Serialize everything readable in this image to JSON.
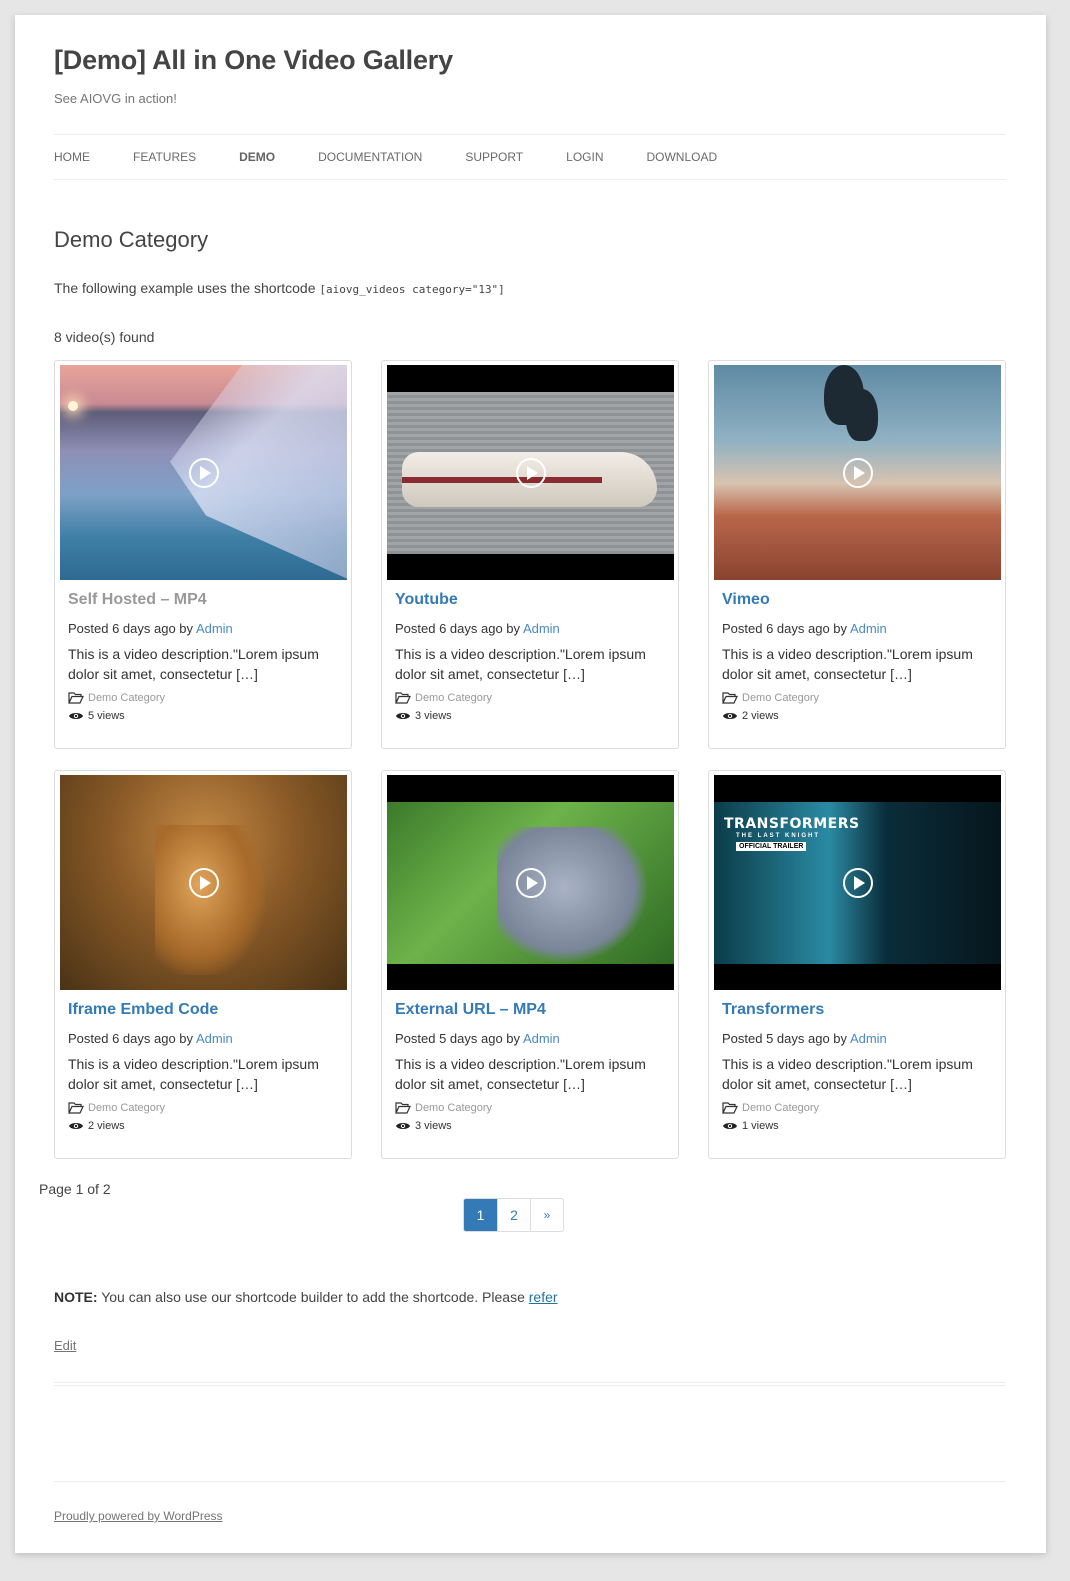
{
  "site": {
    "title": "[Demo] All in One Video Gallery",
    "description": "See AIOVG in action!"
  },
  "nav": {
    "items": [
      {
        "label": "HOME",
        "active": false
      },
      {
        "label": "FEATURES",
        "active": false
      },
      {
        "label": "DEMO",
        "active": true
      },
      {
        "label": "DOCUMENTATION",
        "active": false
      },
      {
        "label": "SUPPORT",
        "active": false
      },
      {
        "label": "LOGIN",
        "active": false
      },
      {
        "label": "DOWNLOAD",
        "active": false
      }
    ]
  },
  "page": {
    "title": "Demo Category",
    "intro_text": "The following example uses the shortcode",
    "shortcode": "[aiovg_videos category=\"13\"]",
    "count_text": "8 video(s) found"
  },
  "videos": [
    {
      "title": "Self Hosted – MP4",
      "posted": "Posted 6 days ago by",
      "author": "Admin",
      "description": "This is a video description.\"Lorem ipsum dolor sit amet, consectetur […]",
      "category": "Demo Category",
      "views": "5 views",
      "thumbnail": "frozen-shoreline-sunset",
      "visited": true
    },
    {
      "title": "Youtube",
      "posted": "Posted 6 days ago by",
      "author": "Admin",
      "description": "This is a video description.\"Lorem ipsum dolor sit amet, consectetur […]",
      "category": "Demo Category",
      "views": "3 views",
      "thumbnail": "lego-spaceship",
      "visited": false
    },
    {
      "title": "Vimeo",
      "posted": "Posted 6 days ago by",
      "author": "Admin",
      "description": "This is a video description.\"Lorem ipsum dolor sit amet, consectetur […]",
      "category": "Demo Category",
      "views": "2 views",
      "thumbnail": "hot-air-balloons",
      "visited": false
    },
    {
      "title": "Iframe Embed Code",
      "posted": "Posted 6 days ago by",
      "author": "Admin",
      "description": "This is a video description.\"Lorem ipsum dolor sit amet, consectetur […]",
      "category": "Demo Category",
      "views": "2 views",
      "thumbnail": "lion",
      "visited": false
    },
    {
      "title": "External URL – MP4",
      "posted": "Posted 5 days ago by",
      "author": "Admin",
      "description": "This is a video description.\"Lorem ipsum dolor sit amet, consectetur […]",
      "category": "Demo Category",
      "views": "3 views",
      "thumbnail": "big-buck-bunny",
      "visited": false
    },
    {
      "title": "Transformers",
      "posted": "Posted 5 days ago by",
      "author": "Admin",
      "description": "This is a video description.\"Lorem ipsum dolor sit amet, consectetur […]",
      "category": "Demo Category",
      "views": "1 views",
      "thumbnail": "transformers-trailer",
      "visited": false,
      "thumb_text": {
        "logo": "TRANSFORMERS",
        "subtitle": "THE LAST KNIGHT",
        "badge": "OFFICIAL TRAILER"
      }
    }
  ],
  "pagination": {
    "info": "Page 1 of 2",
    "pages": [
      "1",
      "2"
    ],
    "current": "1",
    "next": "»"
  },
  "note": {
    "label": "NOTE:",
    "text": "You can also use our shortcode builder to add the shortcode. Please",
    "link": "refer"
  },
  "edit_link": "Edit",
  "footer": {
    "credit": "Proudly powered by WordPress"
  },
  "colors": {
    "link": "#337ab7",
    "author_link": "#4a8ac4",
    "visited_title": "#999999",
    "pager_active_bg": "#337ab7"
  }
}
